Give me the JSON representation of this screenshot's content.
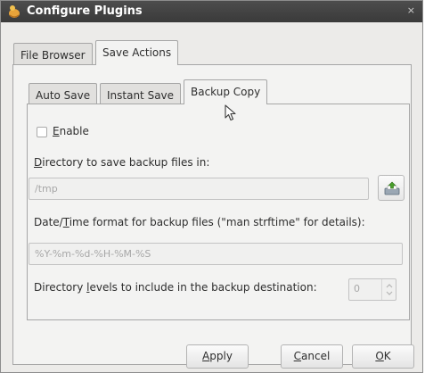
{
  "window": {
    "title": "Configure Plugins",
    "app_icon": "gedit-plugin-icon",
    "close_glyph": "×"
  },
  "outer_tabs": [
    {
      "label": "File Browser",
      "active": false
    },
    {
      "label": "Save Actions",
      "active": true
    }
  ],
  "inner_tabs": [
    {
      "label": "Auto Save",
      "active": false
    },
    {
      "label": "Instant Save",
      "active": false
    },
    {
      "label": "Backup Copy",
      "active": true
    }
  ],
  "backup_copy": {
    "enable": {
      "label_mnemonic": "E",
      "label_rest": "nable",
      "checked": false
    },
    "directory": {
      "label_mnemonic": "D",
      "label_rest": "irectory to save backup files in:",
      "value": "/tmp"
    },
    "format": {
      "label_pre": "Date/",
      "label_mnemonic": "T",
      "label_rest": "ime format for backup files (\"man strftime\" for details):",
      "value": "%Y-%m-%d-%H-%M-%S"
    },
    "levels": {
      "label_pre": "Directory ",
      "label_mnemonic": "l",
      "label_rest": "evels to include in the backup destination:",
      "value": "0"
    }
  },
  "buttons": {
    "apply": {
      "mnemonic": "A",
      "rest": "pply"
    },
    "cancel": {
      "mnemonic": "C",
      "rest": "ancel"
    },
    "ok": {
      "mnemonic": "O",
      "rest": "K"
    }
  }
}
